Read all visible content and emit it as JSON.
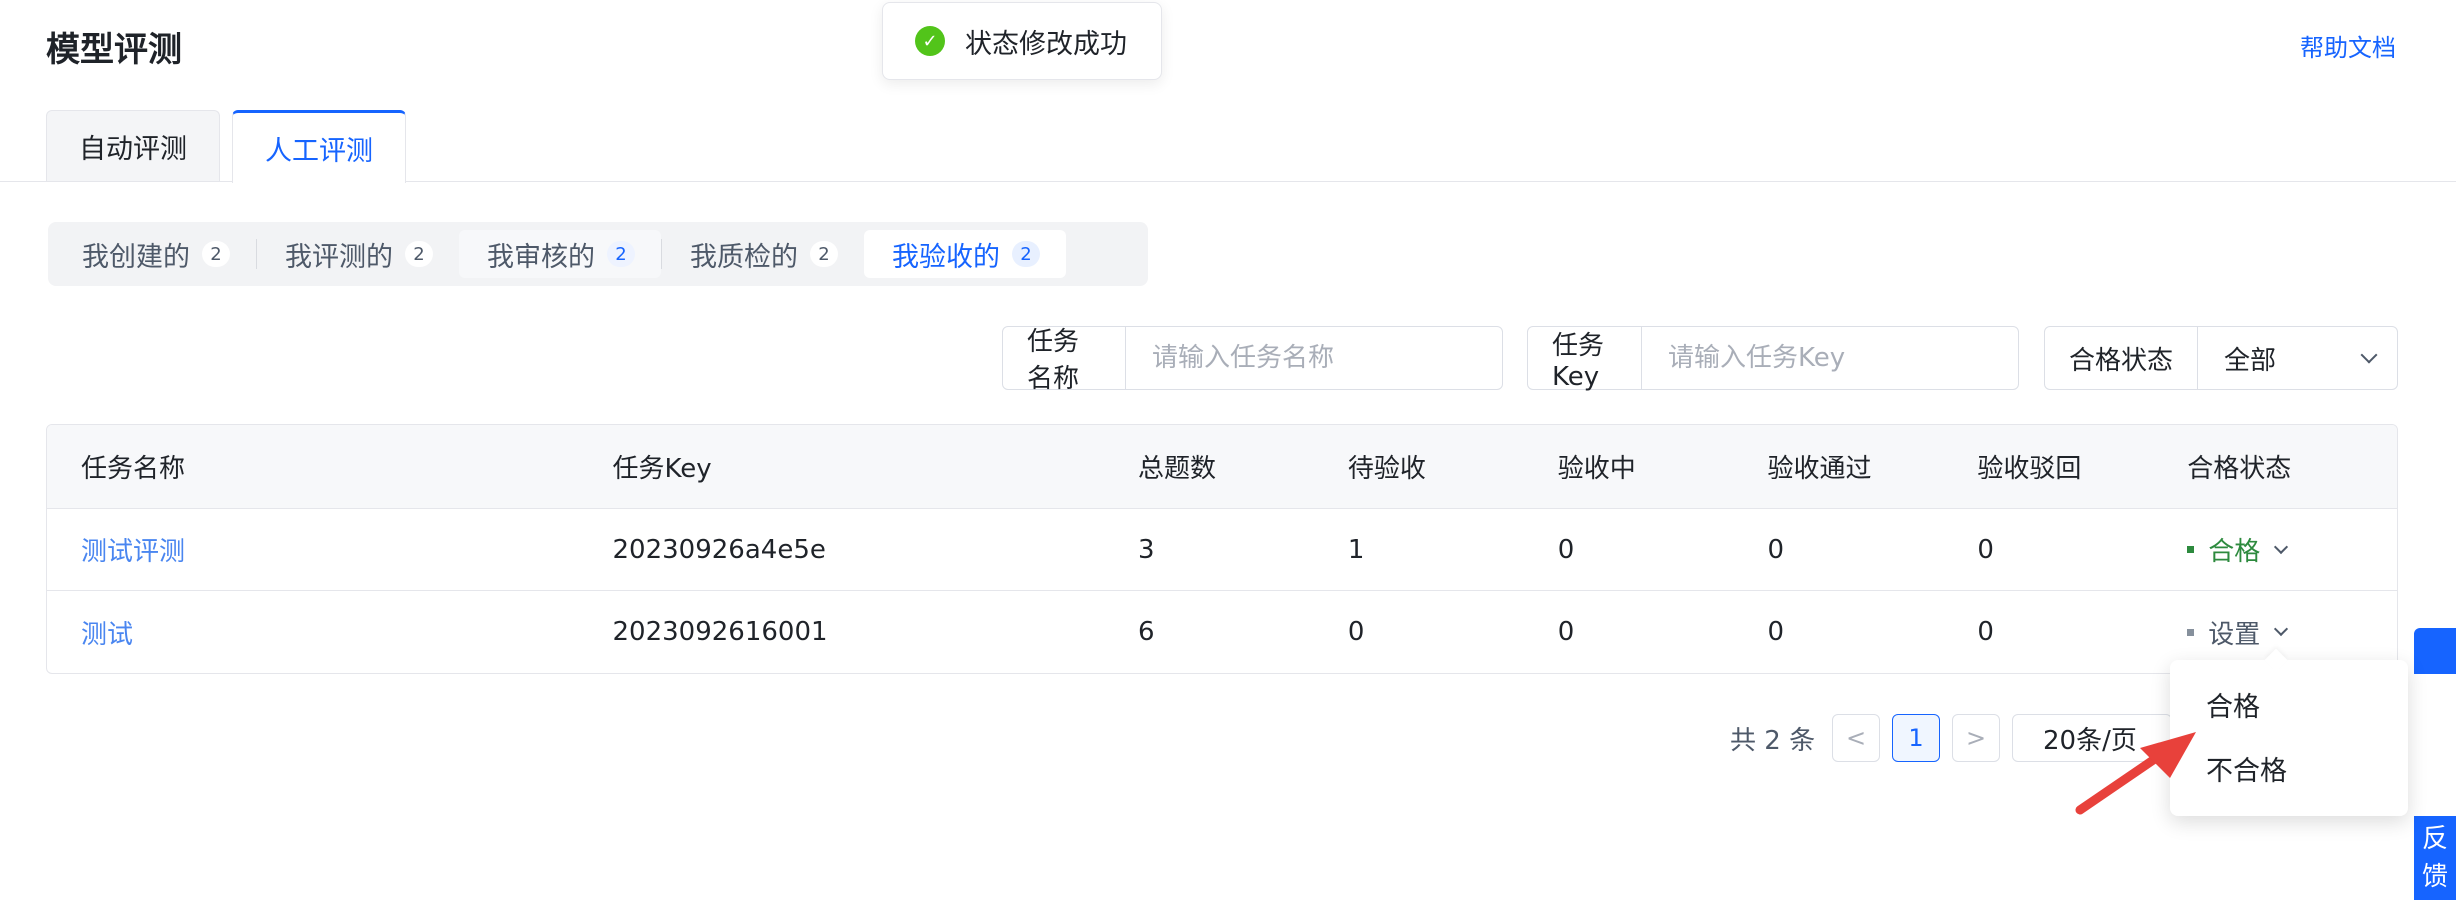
{
  "page": {
    "title": "模型评测",
    "help_link": "帮助文档"
  },
  "toast": {
    "message": "状态修改成功",
    "icon": "check-circle-icon"
  },
  "tabs": [
    {
      "label": "自动评测",
      "active": false
    },
    {
      "label": "人工评测",
      "active": true
    }
  ],
  "segments": [
    {
      "label": "我创建的",
      "count": "2"
    },
    {
      "label": "我评测的",
      "count": "2"
    },
    {
      "label": "我审核的",
      "count": "2"
    },
    {
      "label": "我质检的",
      "count": "2"
    },
    {
      "label": "我验收的",
      "count": "2",
      "active": true
    }
  ],
  "filters": {
    "task_name": {
      "label": "任务名称",
      "placeholder": "请输入任务名称"
    },
    "task_key": {
      "label": "任务Key",
      "placeholder": "请输入任务Key"
    },
    "status": {
      "label": "合格状态",
      "value": "全部"
    }
  },
  "table": {
    "columns": [
      "任务名称",
      "任务Key",
      "总题数",
      "待验收",
      "验收中",
      "验收通过",
      "验收驳回",
      "合格状态"
    ],
    "rows": [
      {
        "name": "测试评测",
        "key": "20230926a4e5e",
        "total": "3",
        "pending": "1",
        "in_progress": "0",
        "passed": "0",
        "rejected": "0",
        "status": "合格",
        "status_color": "#2d8a3e"
      },
      {
        "name": "测试",
        "key": "2023092616001",
        "total": "6",
        "pending": "0",
        "in_progress": "0",
        "passed": "0",
        "rejected": "0",
        "status": "设置",
        "status_color": "#4e5969"
      }
    ]
  },
  "pagination": {
    "total_text": "共 2 条",
    "prev": "<",
    "current_page": "1",
    "next": ">",
    "page_size": "20条/页"
  },
  "dropdown": {
    "options": [
      "合格",
      "不合格"
    ]
  },
  "feedback": {
    "char1": "反",
    "char2": "馈"
  },
  "colors": {
    "primary": "#1664ff",
    "success": "#52c41a",
    "annotation_arrow": "#e8413b"
  }
}
